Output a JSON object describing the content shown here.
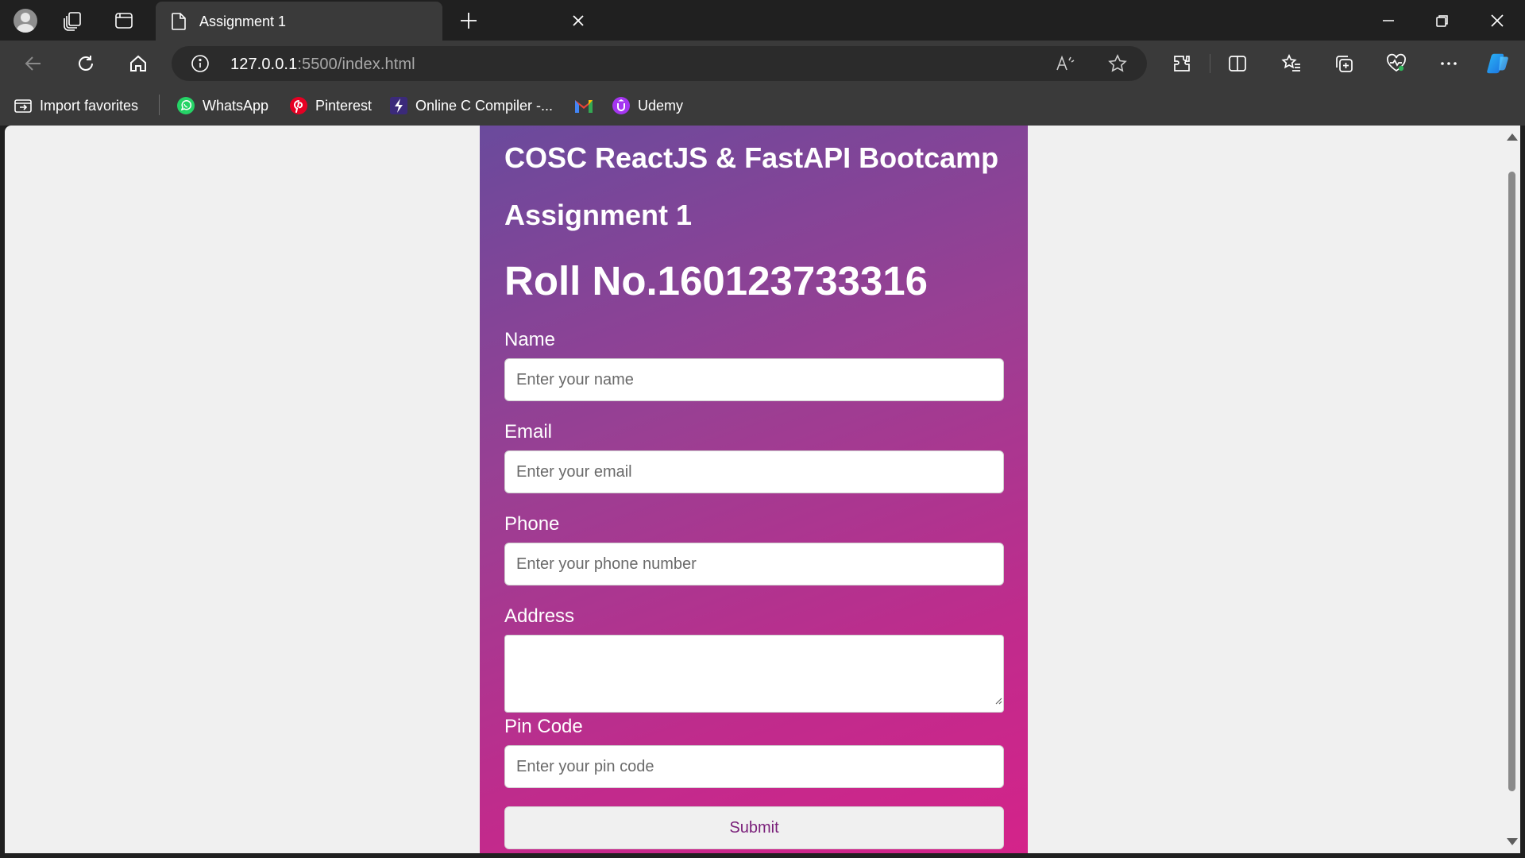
{
  "browser": {
    "tab_title": "Assignment 1",
    "url_host": "127.0.0.1",
    "url_rest": ":5500/index.html",
    "bookmarks": [
      {
        "label": "Import favorites",
        "icon": "import-icon"
      },
      {
        "label": "WhatsApp",
        "icon": "whatsapp-icon"
      },
      {
        "label": "Pinterest",
        "icon": "pinterest-icon"
      },
      {
        "label": "Online C Compiler -...",
        "icon": "compiler-icon"
      },
      {
        "label": "",
        "icon": "gmail-icon"
      },
      {
        "label": "Udemy",
        "icon": "udemy-icon"
      }
    ]
  },
  "page": {
    "course_title": "COSC ReactJS & FastAPI Bootcamp",
    "assignment_title": "Assignment 1",
    "roll_number": "Roll No.160123733316",
    "form": {
      "name_label": "Name",
      "name_placeholder": "Enter your name",
      "email_label": "Email",
      "email_placeholder": "Enter your email",
      "phone_label": "Phone",
      "phone_placeholder": "Enter your phone number",
      "address_label": "Address",
      "pincode_label": "Pin Code",
      "pincode_placeholder": "Enter your pin code",
      "submit_label": "Submit"
    }
  },
  "colors": {
    "gradient_start": "#6a4a9c",
    "gradient_end": "#d4238a",
    "submit_text": "#7a1f7a"
  }
}
